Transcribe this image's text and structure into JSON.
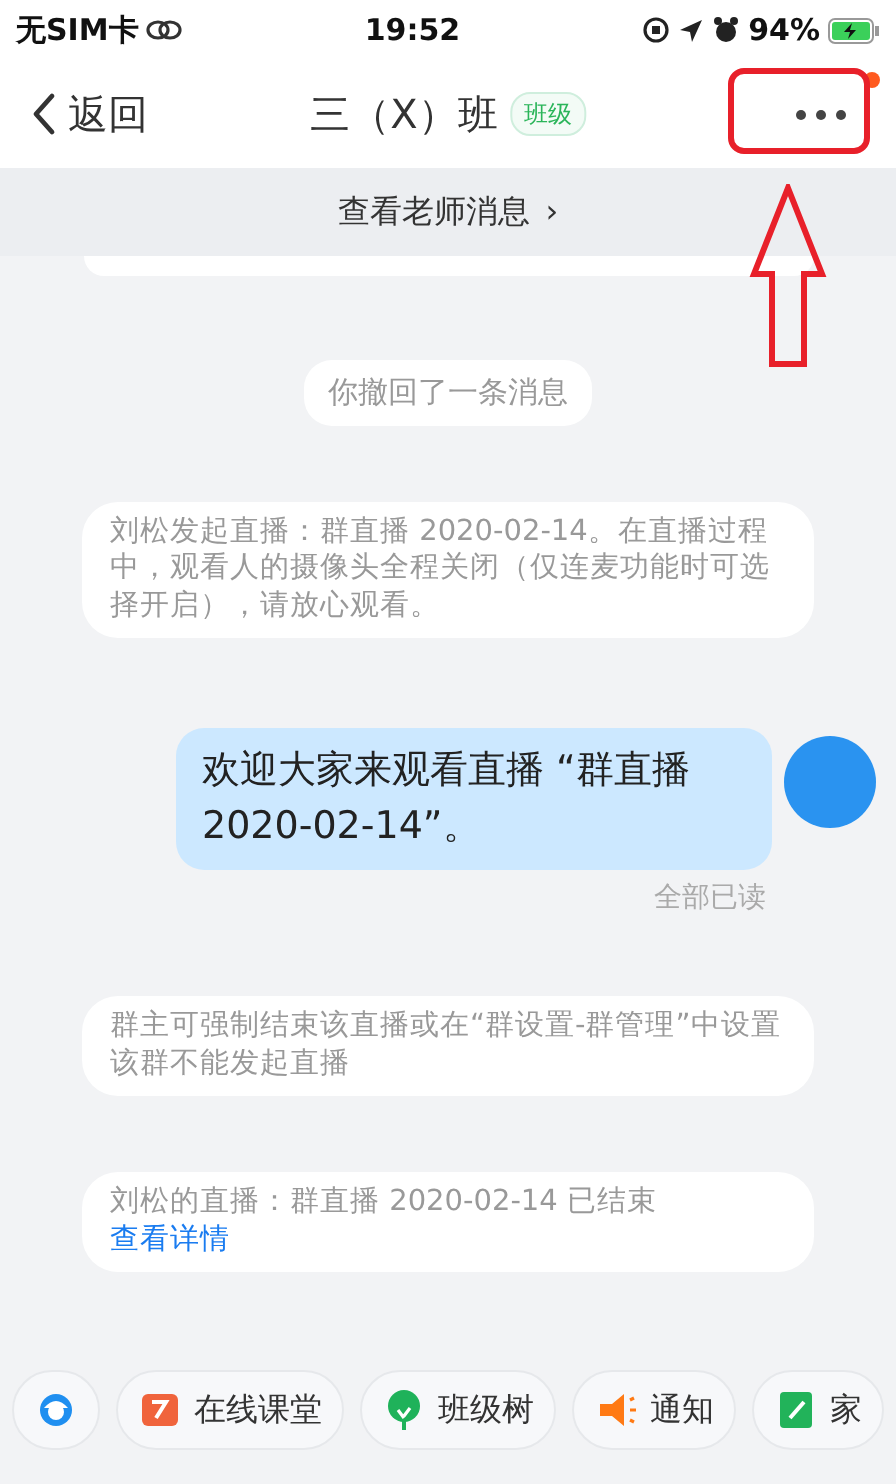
{
  "status_bar": {
    "carrier": "无SIM卡",
    "time": "19:52",
    "battery": "94%"
  },
  "nav": {
    "back": "返回",
    "title": "三（X）班",
    "tag": "班级",
    "more_badge": true
  },
  "banner": {
    "label": "查看老师消息",
    "chevron": "›"
  },
  "messages": [
    {
      "kind": "partial-card"
    },
    {
      "kind": "pill",
      "text": "你撤回了一条消息"
    },
    {
      "kind": "system",
      "parts": [
        {
          "text": "刘松发起直播：群直播 2020-02-14。在直播过程中，观看人的摄像头全程关闭（仅连麦功能时可选择开启），请放心观看。",
          "link": false
        }
      ]
    },
    {
      "kind": "outgoing",
      "text": "欢迎大家来观看直播 “群直播 2020-02-14”。",
      "receipt": "全部已读"
    },
    {
      "kind": "system",
      "parts": [
        {
          "text": "群主可强制结束该直播或在“群设置-群管理”中设置该群不能发起直播",
          "link": false
        }
      ]
    },
    {
      "kind": "system",
      "parts": [
        {
          "text": "刘松的直播：群直播 2020-02-14 已结束 ",
          "link": false
        },
        {
          "text": "查看详情",
          "link": true
        }
      ]
    }
  ],
  "toolbar": [
    {
      "kind": "service"
    },
    {
      "kind": "classroom",
      "label": "在线课堂"
    },
    {
      "kind": "tree",
      "label": "班级树"
    },
    {
      "kind": "notice",
      "label": "通知"
    },
    {
      "kind": "homework",
      "label": "家"
    }
  ]
}
